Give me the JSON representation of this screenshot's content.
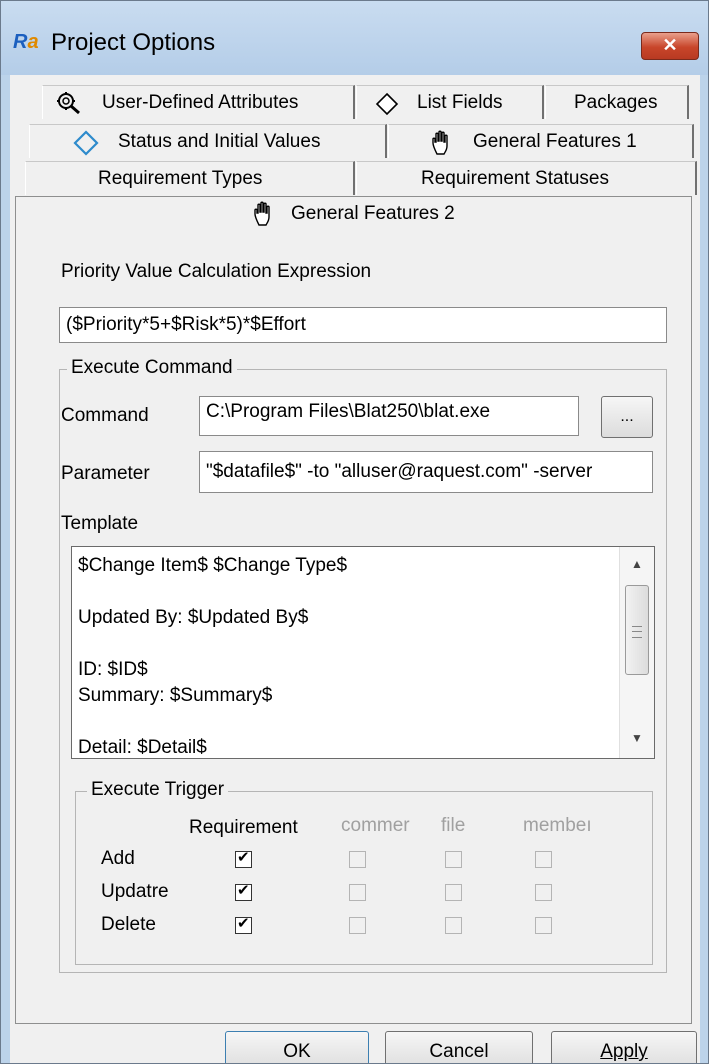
{
  "window": {
    "title": "Project Options",
    "close_label": "✕"
  },
  "tabs": {
    "row1": [
      {
        "label": "User-Defined Attributes",
        "icon": "magnifier-gear-icon"
      },
      {
        "label": "List Fields",
        "icon": "diamond-icon"
      },
      {
        "label": "Packages"
      }
    ],
    "row2": [
      {
        "label": "Status and Initial Values",
        "icon": "cycle-arrows-icon"
      },
      {
        "label": "General Features 1",
        "icon": "hand-icon"
      }
    ],
    "row3": [
      {
        "label": "Requirement Types"
      },
      {
        "label": "Requirement Statuses"
      }
    ],
    "selected": {
      "label": "General Features 2",
      "icon": "hand-icon"
    }
  },
  "priority": {
    "label": "Priority Value Calculation Expression",
    "value": "($Priority*5+$Risk*5)*$Effort"
  },
  "execute_command": {
    "legend": "Execute Command",
    "command_label": "Command",
    "command_value": "C:\\Program Files\\Blat250\\blat.exe",
    "browse_label": "...",
    "parameter_label": "Parameter",
    "parameter_value": "\"$datafile$\" -to \"alluser@raquest.com\" -server",
    "template_label": "Template",
    "template_lines": [
      "$Change Item$ $Change Type$",
      "",
      "Updated By: $Updated By$",
      "",
      "ID: $ID$",
      "Summary: $Summary$",
      "",
      "Detail: $Detail$"
    ]
  },
  "trigger": {
    "legend": "Execute Trigger",
    "columns": [
      "Requirement",
      "commer",
      "file",
      "membeı"
    ],
    "rows": [
      {
        "label": "Add",
        "checks": [
          true,
          false,
          false,
          false
        ]
      },
      {
        "label": "Updatre",
        "checks": [
          true,
          false,
          false,
          false
        ]
      },
      {
        "label": "Delete",
        "checks": [
          true,
          false,
          false,
          false
        ]
      }
    ]
  },
  "buttons": {
    "ok": "OK",
    "cancel": "Cancel",
    "apply": "Apply"
  }
}
